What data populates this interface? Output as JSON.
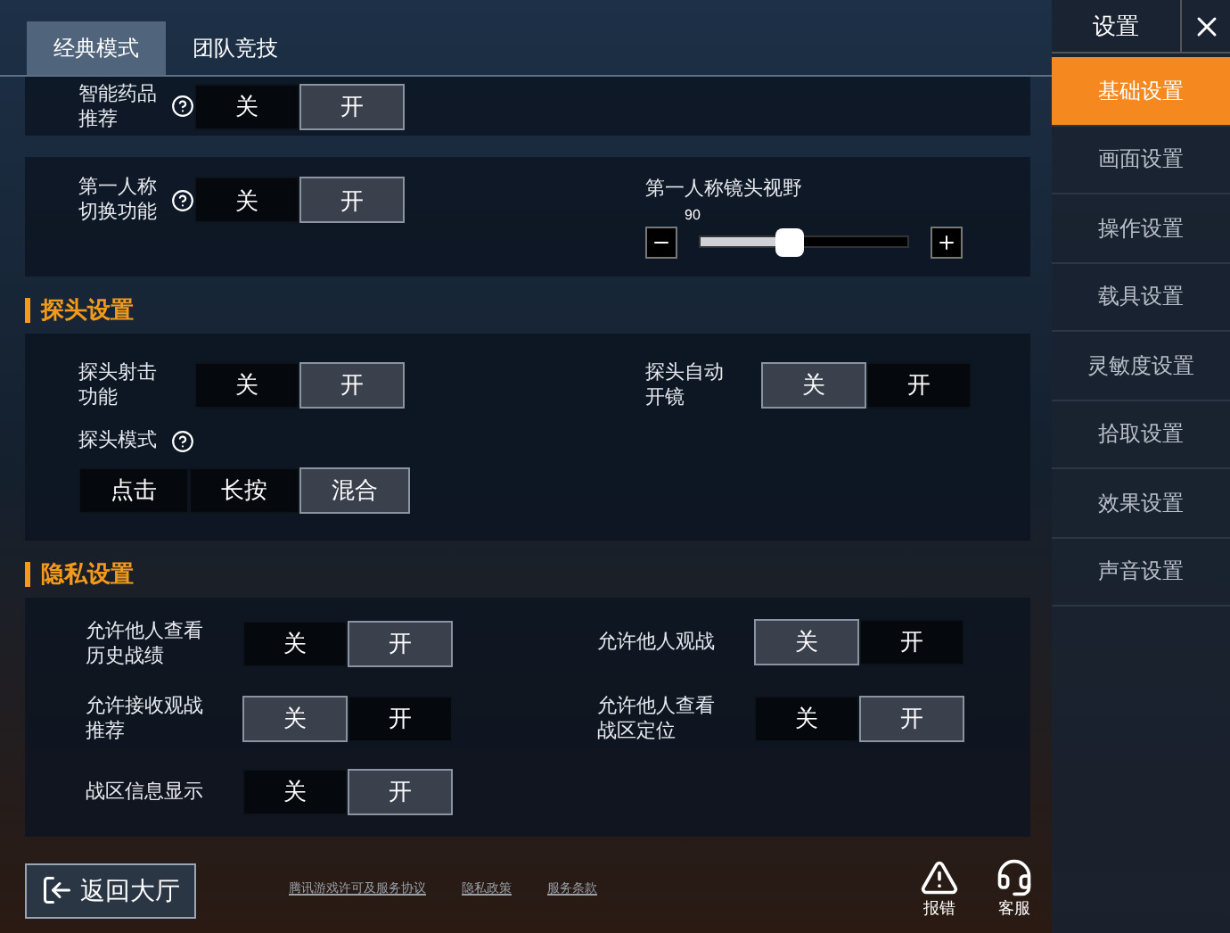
{
  "tabs": [
    {
      "label": "经典模式",
      "selected": true
    },
    {
      "label": "团队竞技",
      "selected": false
    }
  ],
  "sidebar": {
    "title": "设置",
    "items": [
      {
        "label": "基础设置",
        "selected": true
      },
      {
        "label": "画面设置",
        "selected": false
      },
      {
        "label": "操作设置",
        "selected": false
      },
      {
        "label": "载具设置",
        "selected": false
      },
      {
        "label": "灵敏度设置",
        "selected": false
      },
      {
        "label": "拾取设置",
        "selected": false
      },
      {
        "label": "效果设置",
        "selected": false
      },
      {
        "label": "声音设置",
        "selected": false
      }
    ]
  },
  "cards": [
    {
      "rows": [
        [
          {
            "kind": "toggle",
            "label": "智能药品推荐",
            "help": true,
            "options": [
              {
                "label": "关",
                "selected": false
              },
              {
                "label": "开",
                "selected": true
              }
            ]
          }
        ]
      ]
    },
    {
      "rows": [
        [
          {
            "kind": "toggle",
            "label": "第一人称切换功能",
            "help": true,
            "options": [
              {
                "label": "关",
                "selected": false
              },
              {
                "label": "开",
                "selected": true
              }
            ]
          },
          {
            "kind": "slider",
            "label": "第一人称镜头视野",
            "value": "90",
            "level": 0.43
          }
        ]
      ]
    },
    {
      "heading": "探头设置",
      "rows": [
        [
          {
            "kind": "toggle",
            "label": "探头射击功能",
            "help": false,
            "options": [
              {
                "label": "关",
                "selected": false
              },
              {
                "label": "开",
                "selected": true
              }
            ]
          },
          {
            "kind": "toggle",
            "label": "探头自动开镜",
            "help": false,
            "options": [
              {
                "label": "关",
                "selected": true
              },
              {
                "label": "开",
                "selected": false
              }
            ]
          }
        ],
        [
          {
            "kind": "segment",
            "label": "探头模式",
            "help": true,
            "options": [
              {
                "label": "点击",
                "selected": false
              },
              {
                "label": "长按",
                "selected": false
              },
              {
                "label": "混合",
                "selected": true
              }
            ]
          }
        ]
      ]
    },
    {
      "heading": "隐私设置",
      "rows": [
        [
          {
            "kind": "toggle",
            "label": "允许他人查看历史战绩",
            "help": false,
            "options": [
              {
                "label": "关",
                "selected": false
              },
              {
                "label": "开",
                "selected": true
              }
            ]
          },
          {
            "kind": "toggle",
            "label": "允许他人观战",
            "help": false,
            "options": [
              {
                "label": "关",
                "selected": true
              },
              {
                "label": "开",
                "selected": false
              }
            ]
          }
        ],
        [
          {
            "kind": "toggle",
            "label": "允许接收观战推荐",
            "help": false,
            "options": [
              {
                "label": "关",
                "selected": true
              },
              {
                "label": "开",
                "selected": false
              }
            ]
          },
          {
            "kind": "toggle",
            "label": "允许他人查看战区定位",
            "help": false,
            "options": [
              {
                "label": "关",
                "selected": false
              },
              {
                "label": "开",
                "selected": true
              }
            ]
          }
        ],
        [
          {
            "kind": "toggle",
            "label": "战区信息显示",
            "help": false,
            "options": [
              {
                "label": "关",
                "selected": false
              },
              {
                "label": "开",
                "selected": true
              }
            ]
          }
        ]
      ]
    }
  ],
  "footer": {
    "back": "返回大厅",
    "links": [
      "腾讯游戏许可及服务协议",
      "隐私政策",
      "服务条款"
    ],
    "report": "报错",
    "service": "客服"
  }
}
